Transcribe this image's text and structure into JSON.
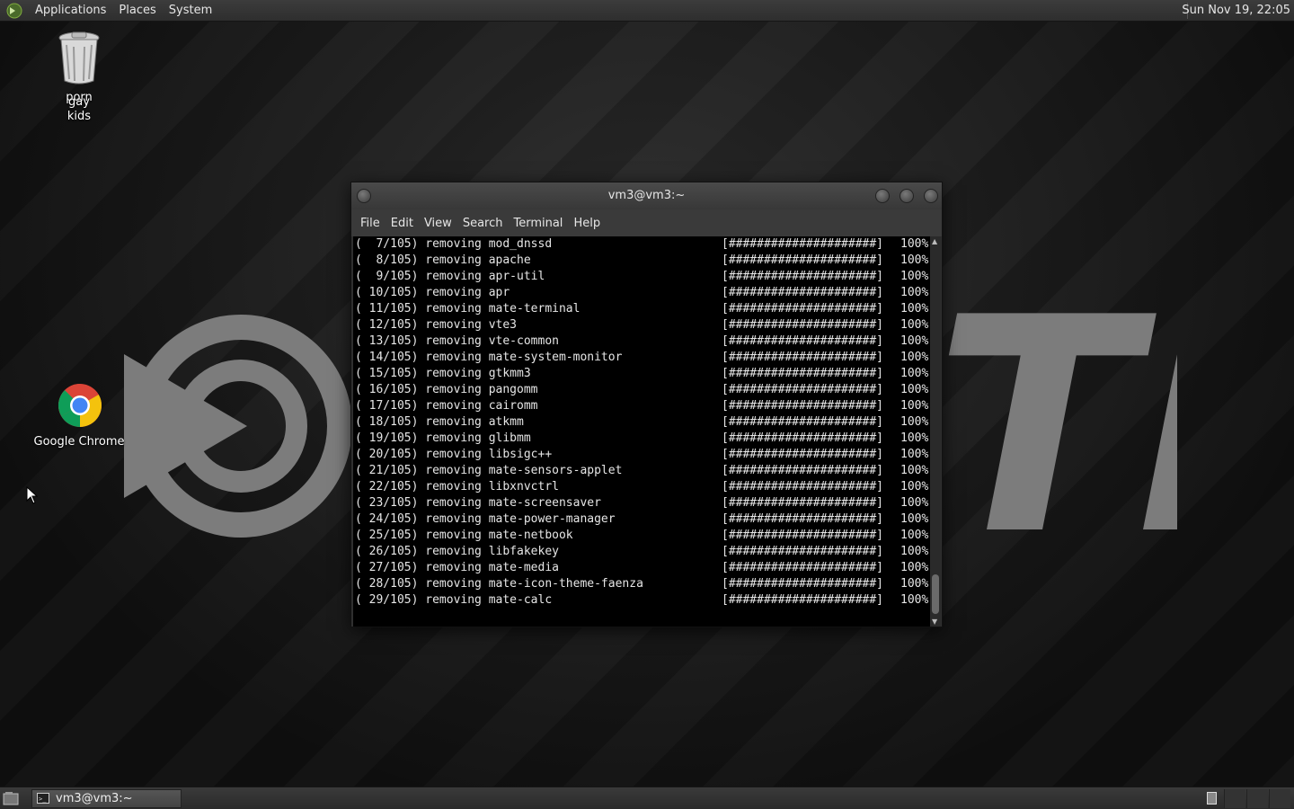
{
  "top_panel": {
    "menus": [
      "Applications",
      "Places",
      "System"
    ],
    "clock": "Sun Nov 19, 22:05"
  },
  "desktop": {
    "trash": {
      "label_line1_a": "porn",
      "label_line1_b": "gay",
      "label_line2": "kids"
    },
    "chrome": {
      "label": "Google Chrome"
    }
  },
  "terminal": {
    "title": "vm3@vm3:~",
    "menu": [
      "File",
      "Edit",
      "View",
      "Search",
      "Terminal",
      "Help"
    ],
    "progress_bar": "[#####################]",
    "lines": [
      {
        "left": "(  7/105) removing mod_dnssd",
        "pct": "100%"
      },
      {
        "left": "(  8/105) removing apache",
        "pct": "100%"
      },
      {
        "left": "(  9/105) removing apr-util",
        "pct": "100%"
      },
      {
        "left": "( 10/105) removing apr",
        "pct": "100%"
      },
      {
        "left": "( 11/105) removing mate-terminal",
        "pct": "100%"
      },
      {
        "left": "( 12/105) removing vte3",
        "pct": "100%"
      },
      {
        "left": "( 13/105) removing vte-common",
        "pct": "100%"
      },
      {
        "left": "( 14/105) removing mate-system-monitor",
        "pct": "100%"
      },
      {
        "left": "( 15/105) removing gtkmm3",
        "pct": "100%"
      },
      {
        "left": "( 16/105) removing pangomm",
        "pct": "100%"
      },
      {
        "left": "( 17/105) removing cairomm",
        "pct": "100%"
      },
      {
        "left": "( 18/105) removing atkmm",
        "pct": "100%"
      },
      {
        "left": "( 19/105) removing glibmm",
        "pct": "100%"
      },
      {
        "left": "( 20/105) removing libsigc++",
        "pct": "100%"
      },
      {
        "left": "( 21/105) removing mate-sensors-applet",
        "pct": "100%"
      },
      {
        "left": "( 22/105) removing libxnvctrl",
        "pct": "100%"
      },
      {
        "left": "( 23/105) removing mate-screensaver",
        "pct": "100%"
      },
      {
        "left": "( 24/105) removing mate-power-manager",
        "pct": "100%"
      },
      {
        "left": "( 25/105) removing mate-netbook",
        "pct": "100%"
      },
      {
        "left": "( 26/105) removing libfakekey",
        "pct": "100%"
      },
      {
        "left": "( 27/105) removing mate-media",
        "pct": "100%"
      },
      {
        "left": "( 28/105) removing mate-icon-theme-faenza",
        "pct": "100%"
      },
      {
        "left": "( 29/105) removing mate-calc",
        "pct": "100%"
      }
    ]
  },
  "taskbar": {
    "window_button": "vm3@vm3:~"
  },
  "wallpaper": {
    "text": "TE"
  },
  "colors": {
    "wallpaper_logo": "#7c7c7c",
    "terminal_bg": "#000000",
    "panel": "#333333"
  }
}
